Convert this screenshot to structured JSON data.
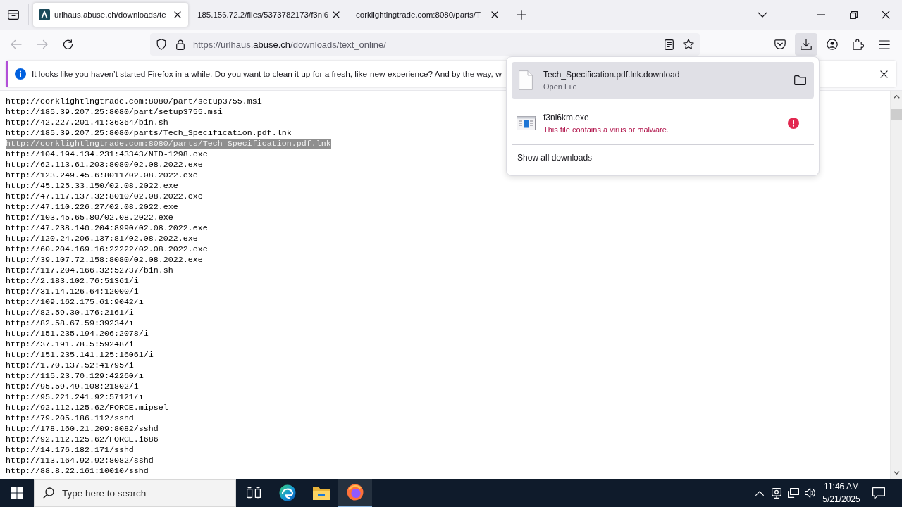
{
  "tab_strip": {
    "tabs": [
      {
        "title": "urlhaus.abuse.ch/downloads/te",
        "favicon": true,
        "selected": true
      },
      {
        "title": "185.156.72.2/files/5373782173/f3nl6",
        "favicon": false,
        "selected": false
      },
      {
        "title": "corklightlngtrade.com:8080/parts/T",
        "favicon": false,
        "selected": false
      }
    ]
  },
  "nav_buttons": [
    {
      "kind": "back",
      "disabled": true
    },
    {
      "kind": "forward",
      "disabled": true
    },
    {
      "kind": "reload",
      "disabled": false
    }
  ],
  "address_bar": {
    "url_prefix": "https://urlhaus.",
    "url_domain": "abuse.ch",
    "url_path": "/downloads/text_online/"
  },
  "downloads_button": {
    "active": true
  },
  "notification": {
    "text": "It looks like you haven’t started Firefox in a while. Do you want to clean it up for a fresh, like-new experience? And by the way, w"
  },
  "lines": [
    {
      "text": "http://corklightlngtrade.com:8080/part/setup3755.msi",
      "selected": false
    },
    {
      "text": "http://185.39.207.25:8080/part/setup3755.msi",
      "selected": false
    },
    {
      "text": "http://42.227.201.41:36364/bin.sh",
      "selected": false
    },
    {
      "text": "http://185.39.207.25:8080/parts/Tech_Specification.pdf.lnk",
      "selected": false
    },
    {
      "text": "http://corklightlngtrade.com:8080/parts/Tech_Specification.pdf.lnk",
      "selected": true
    },
    {
      "text": "http://104.194.134.231:43343/NID-1298.exe",
      "selected": false
    },
    {
      "text": "http://62.113.61.203:8080/02.08.2022.exe",
      "selected": false
    },
    {
      "text": "http://123.249.45.6:8011/02.08.2022.exe",
      "selected": false
    },
    {
      "text": "http://45.125.33.150/02.08.2022.exe",
      "selected": false
    },
    {
      "text": "http://47.117.137.32:8010/02.08.2022.exe",
      "selected": false
    },
    {
      "text": "http://47.110.226.27/02.08.2022.exe",
      "selected": false
    },
    {
      "text": "http://103.45.65.80/02.08.2022.exe",
      "selected": false
    },
    {
      "text": "http://47.238.140.204:8990/02.08.2022.exe",
      "selected": false
    },
    {
      "text": "http://120.24.206.137:81/02.08.2022.exe",
      "selected": false
    },
    {
      "text": "http://60.204.169.16:22222/02.08.2022.exe",
      "selected": false
    },
    {
      "text": "http://39.107.72.158:8080/02.08.2022.exe",
      "selected": false
    },
    {
      "text": "http://117.204.166.32:52737/bin.sh",
      "selected": false
    },
    {
      "text": "http://2.183.102.76:51361/i",
      "selected": false
    },
    {
      "text": "http://31.14.126.64:12000/i",
      "selected": false
    },
    {
      "text": "http://109.162.175.61:9042/i",
      "selected": false
    },
    {
      "text": "http://82.59.30.176:2161/i",
      "selected": false
    },
    {
      "text": "http://82.58.67.59:39234/i",
      "selected": false
    },
    {
      "text": "http://151.235.194.206:2078/i",
      "selected": false
    },
    {
      "text": "http://37.191.78.5:59248/i",
      "selected": false
    },
    {
      "text": "http://151.235.141.125:16061/i",
      "selected": false
    },
    {
      "text": "http://1.70.137.52:41795/i",
      "selected": false
    },
    {
      "text": "http://115.23.70.129:42260/i",
      "selected": false
    },
    {
      "text": "http://95.59.49.108:21802/i",
      "selected": false
    },
    {
      "text": "http://95.221.241.92:57121/i",
      "selected": false
    },
    {
      "text": "http://92.112.125.62/FORCE.mipsel",
      "selected": false
    },
    {
      "text": "http://79.205.186.112/sshd",
      "selected": false
    },
    {
      "text": "http://178.160.21.209:8082/sshd",
      "selected": false
    },
    {
      "text": "http://92.112.125.62/FORCE.i686",
      "selected": false
    },
    {
      "text": "http://14.176.182.171/sshd",
      "selected": false
    },
    {
      "text": "http://113.164.92.92:8082/sshd",
      "selected": false
    },
    {
      "text": "http://88.8.22.161:10010/sshd",
      "selected": false
    }
  ],
  "downloads_panel": {
    "items": [
      {
        "kind": "document",
        "name": "Tech_Specification.pdf.lnk.download",
        "status": "Open File",
        "danger": false,
        "selected": true
      },
      {
        "kind": "executable",
        "name": "f3nl6km.exe",
        "status": "This file contains a virus or malware.",
        "danger": true,
        "selected": false
      }
    ],
    "footer": "Show all downloads"
  },
  "taskbar": {
    "search": {
      "placeholder": "Type here to search"
    },
    "apps": [
      {
        "kind": "task_view",
        "active": false
      },
      {
        "kind": "edge",
        "active": false
      },
      {
        "kind": "file_explorer",
        "active": false
      },
      {
        "kind": "firefox",
        "active": true
      }
    ],
    "time": "11:46 AM",
    "date": "5/21/2025"
  }
}
